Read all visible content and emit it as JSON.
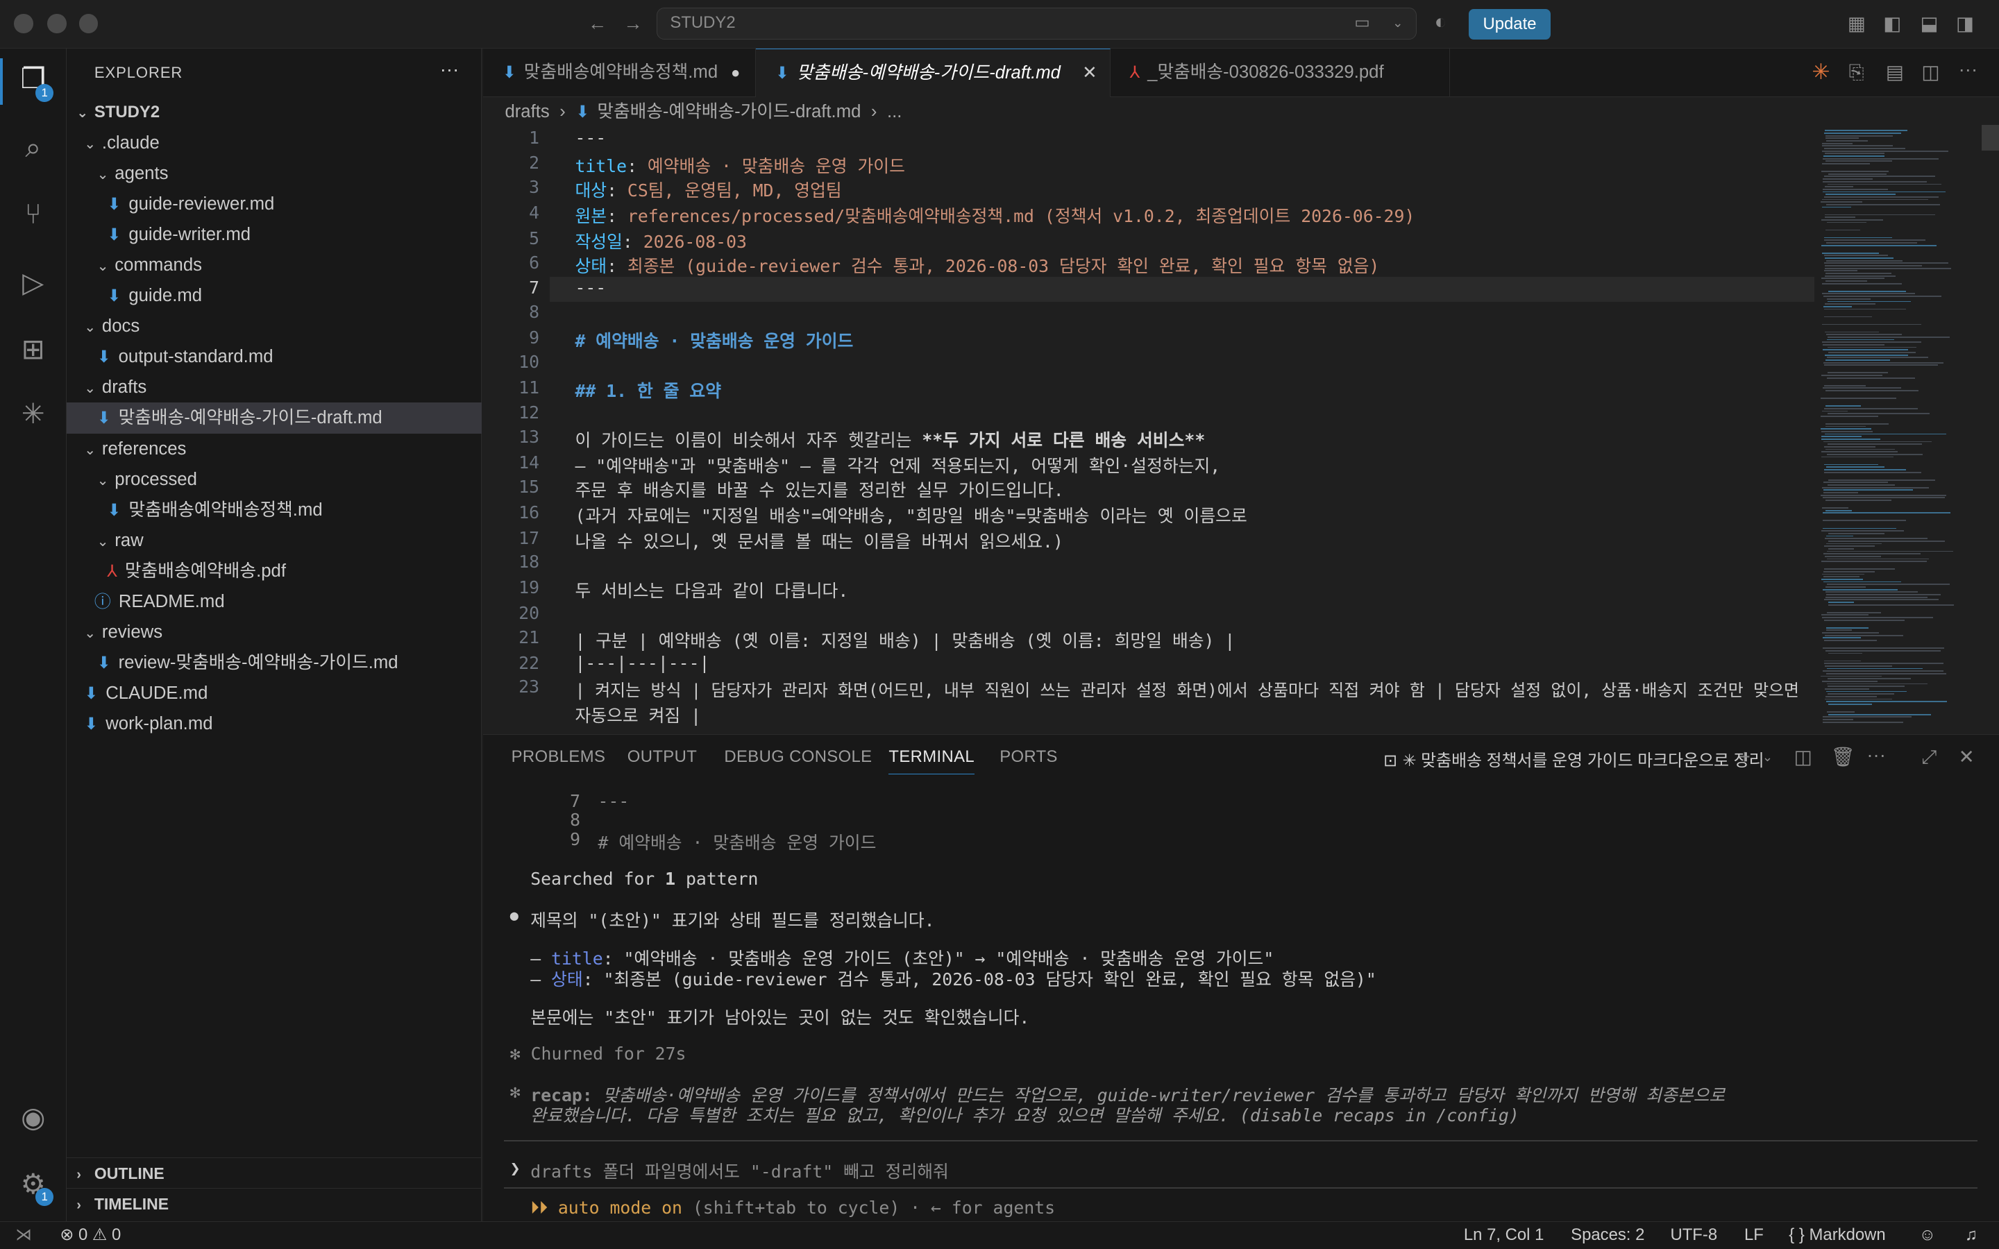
{
  "titlebar": {
    "search_text": "STUDY2",
    "update_label": "Update"
  },
  "activity_badges": {
    "explorer": "1",
    "settings": "1"
  },
  "explorer": {
    "title": "EXPLORER",
    "root": "STUDY2",
    "items": [
      {
        "label": ".claude"
      },
      {
        "label": "agents"
      },
      {
        "label": "guide-reviewer.md"
      },
      {
        "label": "guide-writer.md"
      },
      {
        "label": "commands"
      },
      {
        "label": "guide.md"
      },
      {
        "label": "docs"
      },
      {
        "label": "output-standard.md"
      },
      {
        "label": "drafts"
      },
      {
        "label": "맞춤배송-예약배송-가이드-draft.md"
      },
      {
        "label": "references"
      },
      {
        "label": "processed"
      },
      {
        "label": "맞춤배송예약배송정책.md"
      },
      {
        "label": "raw"
      },
      {
        "label": "맞춤배송예약배송.pdf"
      },
      {
        "label": "README.md"
      },
      {
        "label": "reviews"
      },
      {
        "label": "review-맞춤배송-예약배송-가이드.md"
      },
      {
        "label": "CLAUDE.md"
      },
      {
        "label": "work-plan.md"
      }
    ],
    "outline": "OUTLINE",
    "timeline": "TIMELINE"
  },
  "tabs": [
    {
      "label": "맞춤배송예약배송정책.md"
    },
    {
      "label": "맞춤배송-예약배송-가이드-draft.md"
    },
    {
      "label": "_맞춤배송-030826-033329.pdf"
    }
  ],
  "breadcrumb": {
    "folder": "drafts",
    "file": "맞춤배송-예약배송-가이드-draft.md",
    "more": "..."
  },
  "editor": {
    "line_numbers": [
      "1",
      "2",
      "3",
      "4",
      "5",
      "6",
      "7",
      "8",
      "9",
      "10",
      "11",
      "12",
      "13",
      "14",
      "15",
      "16",
      "17",
      "18",
      "19",
      "20",
      "21",
      "22",
      "23"
    ],
    "l1": "---",
    "l2k": "title",
    "l2v": " 예약배송 · 맞춤배송 운영 가이드",
    "l3k": "대상",
    "l3v": " CS팀, 운영팀, MD, 영업팀",
    "l4k": "원본",
    "l4v": " references/processed/맞춤배송예약배송정책.md (정책서 v1.0.2, 최종업데이트 2026-06-29)",
    "l5k": "작성일",
    "l5v": " 2026-08-03",
    "l6k": "상태",
    "l6v": " 최종본 (guide-reviewer 검수 통과, 2026-08-03 담당자 확인 완료, 확인 필요 항목 없음)",
    "l7": "---",
    "l9": "# 예약배송 · 맞춤배송 운영 가이드",
    "l11": "## 1. 한 줄 요약",
    "l13a": "이 가이드는 이름이 비슷해서 자주 헷갈리는 ",
    "l13b": "**두 가지 서로 다른 배송 서비스**",
    "l14": "— \"예약배송\"과 \"맞춤배송\" — 를 각각 언제 적용되는지, 어떻게 확인·설정하는지,",
    "l15": "주문 후 배송지를 바꿀 수 있는지를 정리한 실무 가이드입니다.",
    "l16": "(과거 자료에는 \"지정일 배송\"=예약배송, \"희망일 배송\"=맞춤배송 이라는 옛 이름으로",
    "l17": "나올 수 있으니, 옛 문서를 볼 때는 이름을 바꿔서 읽으세요.)",
    "l19": "두 서비스는 다음과 같이 다릅니다.",
    "l21": "| 구분 | 예약배송 (옛 이름: 지정일 배송) | 맞춤배송 (옛 이름: 희망일 배송) |",
    "l22": "|---|---|---|",
    "l23": "| 켜지는 방식 | 담당자가 관리자 화면(어드민, 내부 직원이 쓰는 관리자 설정 화면)에서 상품마다 직접 켜야 함 | 담당자 설정 없이, 상품·배송지 조건만 맞으면",
    "l23b": "자동으로 켜짐 |"
  },
  "panel": {
    "tabs": [
      "PROBLEMS",
      "OUTPUT",
      "DEBUG CONSOLE",
      "TERMINAL",
      "PORTS"
    ],
    "terminal_title": "✳ 맞춤배송 정책서를 운영 가이드 마크다운으로 정리"
  },
  "terminal": {
    "n7": "7",
    "t7": "---",
    "n8": "8",
    "n9": "9",
    "t9": "# 예약배송 · 맞춤배송 운영 가이드",
    "searched_a": "Searched for ",
    "searched_b": "1",
    "searched_c": " pattern",
    "bullet": "●",
    "summary": "제목의 \"(초안)\" 표기와 상태 필드를 정리했습니다.",
    "dash": "– ",
    "f1k": "title",
    "f1v": ": \"예약배송 · 맞춤배송 운영 가이드 (초안)\" → \"예약배송 · 맞춤배송 운영 가이드\"",
    "f2k": "상태",
    "f2v": ": \"최종본 (guide-reviewer 검수 통과, 2026-08-03 담당자 확인 완료, 확인 필요 항목 없음)\"",
    "body": "본문에는 \"초안\" 표기가 남아있는 곳이 없는 것도 확인했습니다.",
    "churned": "✻ Churned for 27s",
    "recap_star": "✻",
    "recap_label": "recap:",
    "recap1": " 맞춤배송·예약배송 운영 가이드를 정책서에서 만드는 작업으로, guide-writer/reviewer 검수를 통과하고 담당자 확인까지 반영해 최종본으로",
    "recap2": "완료했습니다. 다음 특별한 조치는 필요 없고, 확인이나 추가 요청 있으면 말씀해 주세요. (disable recaps in /config)",
    "prompt": "❯",
    "input": "drafts 폴더 파일명에서도 \"-draft\" 빼고 정리해줘",
    "mode_a": "⏵⏵ auto mode on",
    "mode_b": " (shift+tab to cycle) · ← for agents"
  },
  "status": {
    "errors": "0",
    "warnings": "0",
    "position": "Ln 7, Col 1",
    "spaces": "Spaces: 2",
    "encoding": "UTF-8",
    "eol": "LF",
    "language": "Markdown"
  }
}
